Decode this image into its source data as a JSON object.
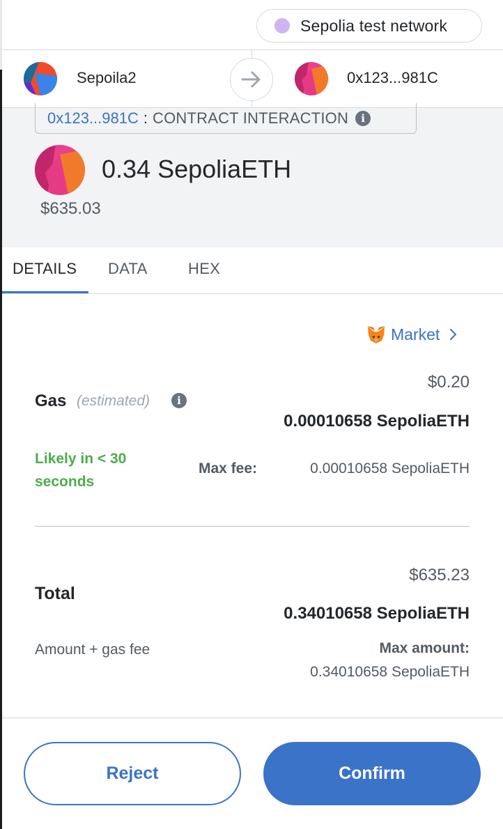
{
  "network": {
    "label": "Sepolia test network"
  },
  "header": {
    "from_account": "Sepoila2",
    "to_account": "0x123...981C"
  },
  "contract": {
    "address": "0x123...981C",
    "separator": ":",
    "label": "CONTRACT INTERACTION"
  },
  "amount": {
    "value": "0.34 SepoliaETH",
    "fiat": "$635.03"
  },
  "tabs": [
    {
      "label": "DETAILS",
      "active": true
    },
    {
      "label": "DATA",
      "active": false
    },
    {
      "label": "HEX",
      "active": false
    }
  ],
  "gas": {
    "market_label": "Market",
    "label": "Gas",
    "estimated": "(estimated)",
    "fiat": "$0.20",
    "eth": "0.00010658 SepoliaETH",
    "likely": "Likely in < 30 seconds",
    "max_fee_label": "Max fee:",
    "max_fee_value": "0.00010658 SepoliaETH"
  },
  "total": {
    "label": "Total",
    "fiat": "$635.23",
    "eth": "0.34010658 SepoliaETH",
    "sub_label": "Amount + gas fee",
    "max_amount_label": "Max amount:",
    "max_amount_value": "0.34010658 SepoliaETH"
  },
  "buttons": {
    "reject": "Reject",
    "confirm": "Confirm"
  },
  "colors": {
    "accent": "#3a73c7",
    "success": "#4cad4c",
    "network_dot": "#cfb5f0"
  }
}
